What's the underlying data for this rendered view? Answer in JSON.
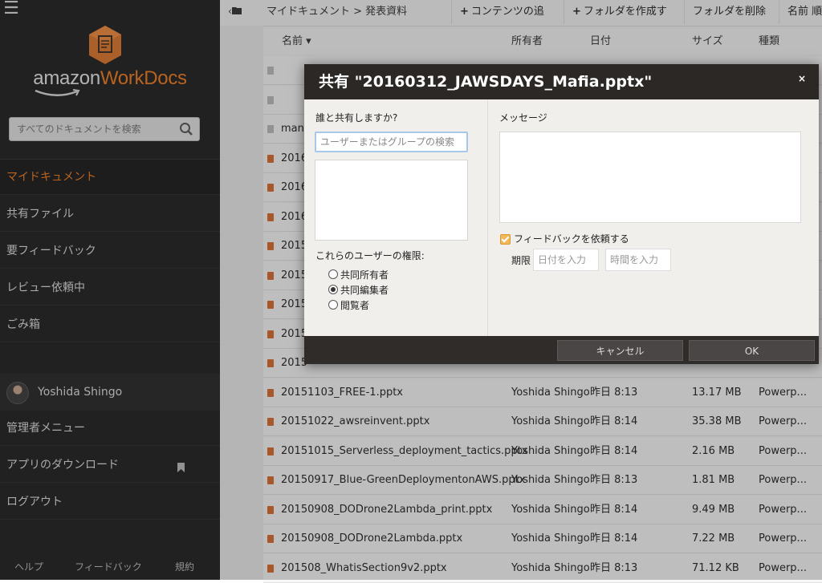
{
  "sidebar": {
    "logo_text_left": "amazon",
    "logo_text_right": "WorkDocs",
    "search_placeholder": "すべてのドキュメントを検索",
    "nav": [
      {
        "label": "マイドキュメント",
        "active": true
      },
      {
        "label": "共有ファイル"
      },
      {
        "label": "要フィードバック"
      },
      {
        "label": "レビュー依頼中"
      },
      {
        "label": "ごみ箱"
      }
    ],
    "user_name": "Yoshida Shingo",
    "admin_menu": "管理者メニュー",
    "app_download": "アプリのダウンロード",
    "logout": "ログアウト",
    "footer": {
      "help": "ヘルプ",
      "feedback": "フィードバック",
      "terms": "規約"
    }
  },
  "toolbar": {
    "breadcrumb": "マイドキュメント > 発表資料",
    "add_content": "コンテンツの追加",
    "create_folder": "フォルダを作成する",
    "delete_folder": "フォルダを削除",
    "sort": "名前 順"
  },
  "columns": {
    "name": "名前 ▾",
    "owner": "所有者",
    "date": "日付",
    "size": "サイズ",
    "type": "種類"
  },
  "rows": [
    {
      "name": "",
      "owner": "",
      "date": "",
      "size": "",
      "type": ""
    },
    {
      "name": "",
      "owner": "",
      "date": "",
      "size": "",
      "type": ""
    },
    {
      "name": "many",
      "owner": "",
      "date": "",
      "size": "",
      "type": ""
    },
    {
      "name": "2016",
      "owner": "",
      "date": "",
      "size": "",
      "type": ""
    },
    {
      "name": "2016",
      "owner": "",
      "date": "",
      "size": "",
      "type": ""
    },
    {
      "name": "2016",
      "owner": "",
      "date": "",
      "size": "",
      "type": ""
    },
    {
      "name": "2015",
      "owner": "",
      "date": "",
      "size": "",
      "type": ""
    },
    {
      "name": "2015",
      "owner": "",
      "date": "",
      "size": "",
      "type": ""
    },
    {
      "name": "2015",
      "owner": "",
      "date": "",
      "size": "",
      "type": ""
    },
    {
      "name": "2015",
      "owner": "",
      "date": "",
      "size": "",
      "type": ""
    },
    {
      "name": "2015",
      "owner": "",
      "date": "",
      "size": "",
      "type": ""
    },
    {
      "name": "20151103_FREE-1.pptx",
      "owner": "Yoshida Shingo",
      "date": "昨日 8:13",
      "size": "13.17 MB",
      "type": "Powerp..."
    },
    {
      "name": "20151022_awsreinvent.pptx",
      "owner": "Yoshida Shingo",
      "date": "昨日 8:14",
      "size": "35.38 MB",
      "type": "Powerp..."
    },
    {
      "name": "20151015_Serverless_deployment_tactics.pptx",
      "owner": "Yoshida Shingo",
      "date": "昨日 8:14",
      "size": "2.16 MB",
      "type": "Powerp..."
    },
    {
      "name": "20150917_Blue-GreenDeploymentonAWS.pptx",
      "owner": "Yoshida Shingo",
      "date": "昨日 8:13",
      "size": "1.81 MB",
      "type": "Powerp..."
    },
    {
      "name": "20150908_DODrone2Lambda_print.pptx",
      "owner": "Yoshida Shingo",
      "date": "昨日 8:14",
      "size": "9.49 MB",
      "type": "Powerp..."
    },
    {
      "name": "20150908_DODrone2Lambda.pptx",
      "owner": "Yoshida Shingo",
      "date": "昨日 8:14",
      "size": "7.22 MB",
      "type": "Powerp..."
    },
    {
      "name": "201508_WhatisSection9v2.pptx",
      "owner": "Yoshida Shingo",
      "date": "昨日 8:13",
      "size": "71.12 KB",
      "type": "Powerp..."
    }
  ],
  "modal": {
    "title": "共有 \"20160312_JAWSDAYS_Mafia.pptx\"",
    "close": "×",
    "share_with_label": "誰と共有しますか?",
    "share_placeholder": "ユーザーまたはグループの検索",
    "permission_label": "これらのユーザーの権限:",
    "permissions": [
      {
        "label": "共同所有者",
        "checked": false
      },
      {
        "label": "共同編集者",
        "checked": true
      },
      {
        "label": "閲覧者",
        "checked": false
      }
    ],
    "message_label": "メッセージ",
    "feedback_label": "フィードバックを依頼する",
    "deadline_label": "期限",
    "date_placeholder": "日付を入力",
    "time_placeholder": "時間を入力",
    "cancel": "キャンセル",
    "ok": "OK"
  },
  "colors": {
    "accent": "#f07b1c",
    "sidebar_bg": "#1f1f1f",
    "modal_header": "#2b2826"
  }
}
